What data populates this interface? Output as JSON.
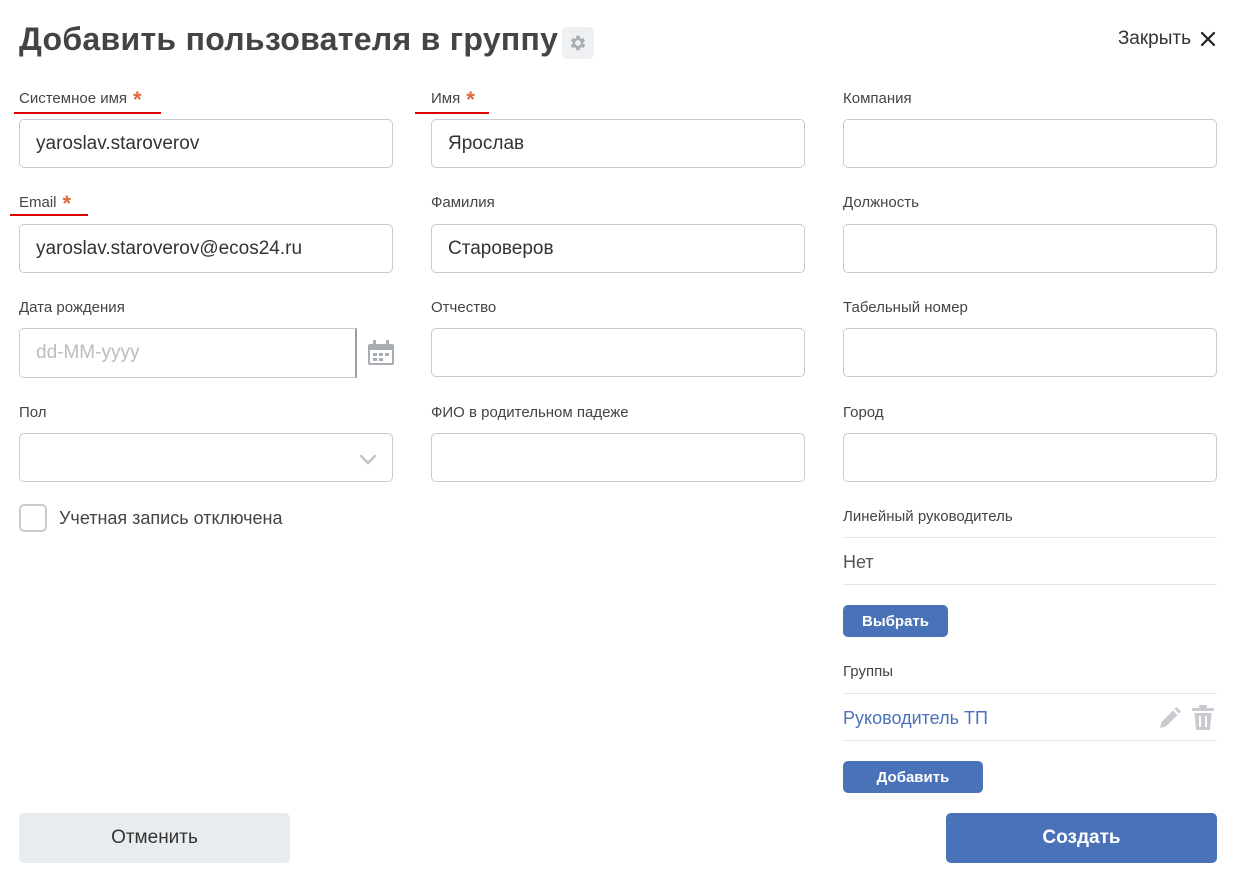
{
  "header": {
    "title": "Добавить пользователя в группу",
    "close_label": "Закрыть",
    "gear_icon": "gear-icon",
    "close_icon": "close-icon"
  },
  "fields": {
    "system_name": {
      "label": "Системное имя",
      "required_mark": "*",
      "value": "yaroslav.staroverov"
    },
    "first_name": {
      "label": "Имя",
      "required_mark": "*",
      "value": "Ярослав"
    },
    "company": {
      "label": "Компания",
      "value": ""
    },
    "email": {
      "label": "Email",
      "required_mark": "*",
      "value": "yaroslav.staroverov@ecos24.ru"
    },
    "last_name": {
      "label": "Фамилия",
      "value": "Староверов"
    },
    "position": {
      "label": "Должность",
      "value": ""
    },
    "birth_date": {
      "label": "Дата рождения",
      "placeholder": "dd-MM-yyyy",
      "calendar_icon": "calendar-icon"
    },
    "middle_name": {
      "label": "Отчество",
      "value": ""
    },
    "employee_number": {
      "label": "Табельный номер",
      "value": ""
    },
    "gender": {
      "label": "Пол",
      "value": "",
      "chevron_icon": "chevron-down-icon"
    },
    "genitive_name": {
      "label": "ФИО в родительном падеже",
      "value": ""
    },
    "city": {
      "label": "Город",
      "value": ""
    },
    "account_disabled": {
      "label": "Учетная запись отключена",
      "checked": false
    }
  },
  "manager": {
    "label": "Линейный руководитель",
    "value": "Нет",
    "select_button": "Выбрать"
  },
  "groups": {
    "label": "Группы",
    "items": [
      {
        "name": "Руководитель ТП"
      }
    ],
    "edit_icon": "pencil-icon",
    "delete_icon": "trash-icon",
    "add_button": "Добавить"
  },
  "footer": {
    "cancel_label": "Отменить",
    "create_label": "Создать"
  },
  "colors": {
    "accent": "#4a72b8",
    "required": "#e0663b",
    "underline": "#dd0000",
    "text": "#444444",
    "border": "#c8ccd0"
  }
}
